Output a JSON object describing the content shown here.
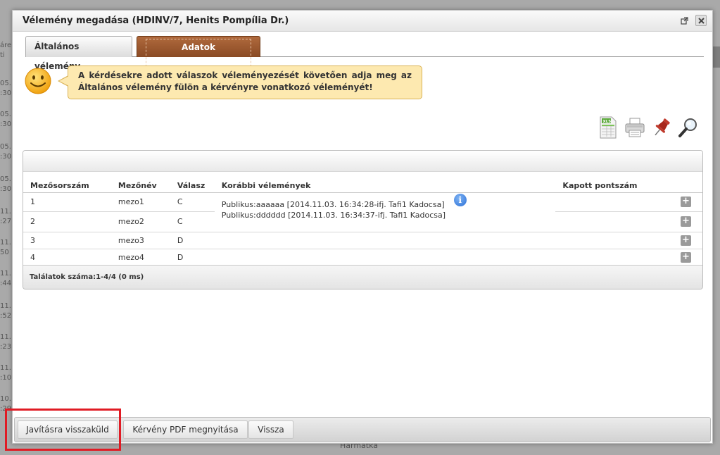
{
  "background": {
    "left_fragments": [
      "áre",
      "ti",
      "05.",
      ":30",
      "05.",
      ":30",
      "05.",
      ":30",
      "05.",
      ":30",
      "11.",
      ":27",
      "11.",
      "50",
      "11.",
      ":44",
      "11.",
      ":52",
      "11.",
      ":23",
      "11.",
      ":10",
      "10.",
      ":29"
    ],
    "footer_text": "Harmatka"
  },
  "dialog": {
    "title": "Vélemény megadása (HDINV/7, Henits Pompília Dr.)",
    "popout_icon": "external-link-icon",
    "close_icon": "close-icon"
  },
  "tabs": [
    {
      "label": "Általános vélemény",
      "active": false
    },
    {
      "label": "Adatok véleményezése",
      "active": true
    }
  ],
  "tip": {
    "text": "A kérdésekre adott válaszok véleményezését követően adja meg az Általános vélemény fülön a kérvényre vonatkozó véleményét!"
  },
  "toolbar": {
    "icons": [
      "xls-export-icon",
      "print-icon",
      "pin-icon",
      "search-icon"
    ]
  },
  "grid": {
    "headers": {
      "number": "Mezősorszám",
      "name": "Mezőnév",
      "answer": "Válasz",
      "previous": "Korábbi vélemények",
      "score": "Kapott pontszám"
    },
    "rows": [
      {
        "number": "1",
        "name": "mezo1",
        "answer": "C"
      },
      {
        "number": "2",
        "name": "mezo2",
        "answer": "C"
      },
      {
        "number": "3",
        "name": "mezo3",
        "answer": "D"
      },
      {
        "number": "4",
        "name": "mezo4",
        "answer": "D"
      }
    ],
    "previous_opinions": [
      "Publikus:aaaaaa [2014.11.03. 16:34:28-ifj. Tafi1 Kadocsa]",
      "Publikus:dddddd [2014.11.03. 16:34:37-ifj. Tafi1 Kadocsa]"
    ],
    "info_glyph": "i",
    "plus_glyph": "+",
    "footer": "Találatok száma:1-4/4 (0 ms)"
  },
  "buttons": {
    "return_label": "Javításra visszaküld",
    "pdf_label": "Kérvény PDF megnyitása",
    "back_label": "Vissza"
  },
  "colors": {
    "active_tab": "#9b5a31",
    "tip_bg": "#fde9b0",
    "highlight": "#e01b24"
  }
}
